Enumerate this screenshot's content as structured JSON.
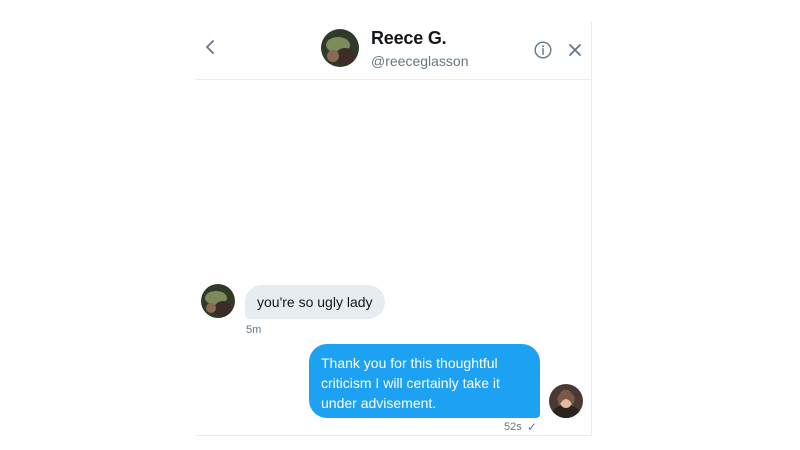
{
  "conversation": {
    "name": "Reece G.",
    "handle": "@reeceglasson"
  },
  "icons": {
    "back": "chevron-left-icon",
    "info": "info-icon",
    "close": "close-icon",
    "read_receipt": "check-icon"
  },
  "messages": [
    {
      "direction": "incoming",
      "text": "you're so ugly lady",
      "time": "5m"
    },
    {
      "direction": "outgoing",
      "text": "Thank you for this thoughtful criticism I will certainly take it under advisement.",
      "time": "52s",
      "receipt": "✓"
    }
  ],
  "colors": {
    "outgoing_bubble": "#1da1f2",
    "incoming_bubble": "#e6ecf0",
    "secondary_text": "#657786"
  }
}
